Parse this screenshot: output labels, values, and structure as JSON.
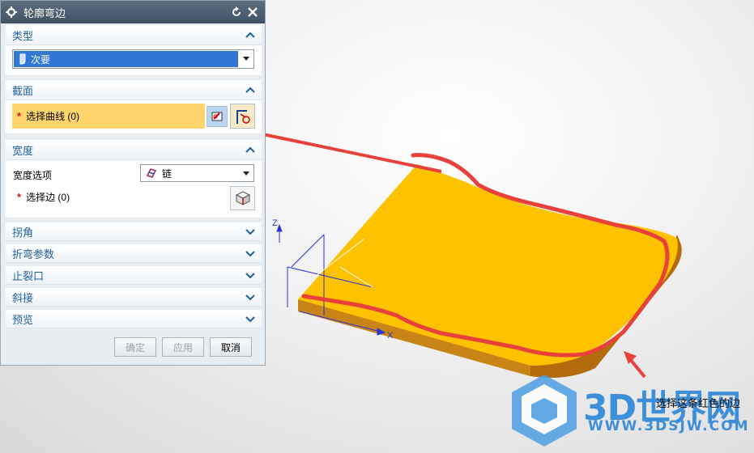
{
  "dialog": {
    "title": "轮廓弯边",
    "sections": {
      "type": {
        "label": "类型",
        "value": "次要"
      },
      "section": {
        "label": "截面",
        "select_curve": "选择曲线 (0)"
      },
      "width": {
        "label": "宽度",
        "option_label": "宽度选项",
        "option_value": "链",
        "select_edge": "选择边 (0)"
      },
      "miter_corner": {
        "label": "拐角"
      },
      "bend_params": {
        "label": "折弯参数"
      },
      "relief": {
        "label": "止裂口"
      },
      "miter": {
        "label": "斜接"
      },
      "preview": {
        "label": "预览"
      }
    },
    "buttons": {
      "ok": "确定",
      "apply": "应用",
      "cancel": "取消"
    }
  },
  "viewport": {
    "axis_z": "Z",
    "axis_x": "X",
    "annotation": "选择这条红色的边"
  },
  "watermark": {
    "brand": "3D世界网",
    "url": "WWW.3DSJW.COM"
  },
  "colors": {
    "accent": "#1f5f9e",
    "highlight": "#ffd66e",
    "part": "#ffc200",
    "markup": "#e8403a"
  }
}
